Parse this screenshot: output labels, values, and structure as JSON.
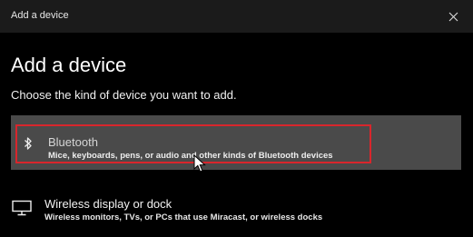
{
  "window": {
    "title": "Add a device"
  },
  "main": {
    "heading": "Add a device",
    "subheading": "Choose the kind of device you want to add."
  },
  "options": [
    {
      "icon": "bluetooth-icon",
      "title": "Bluetooth",
      "description": "Mice, keyboards, pens, or audio and other kinds of Bluetooth devices",
      "selected": true
    },
    {
      "icon": "monitor-icon",
      "title": "Wireless display or dock",
      "description": "Wireless monitors, TVs, or PCs that use Miracast, or wireless docks",
      "selected": false
    }
  ],
  "colors": {
    "background": "#000000",
    "titlebar": "#1b1b1b",
    "selected_option": "#4a4a4a",
    "highlight_border": "#d8262c"
  }
}
